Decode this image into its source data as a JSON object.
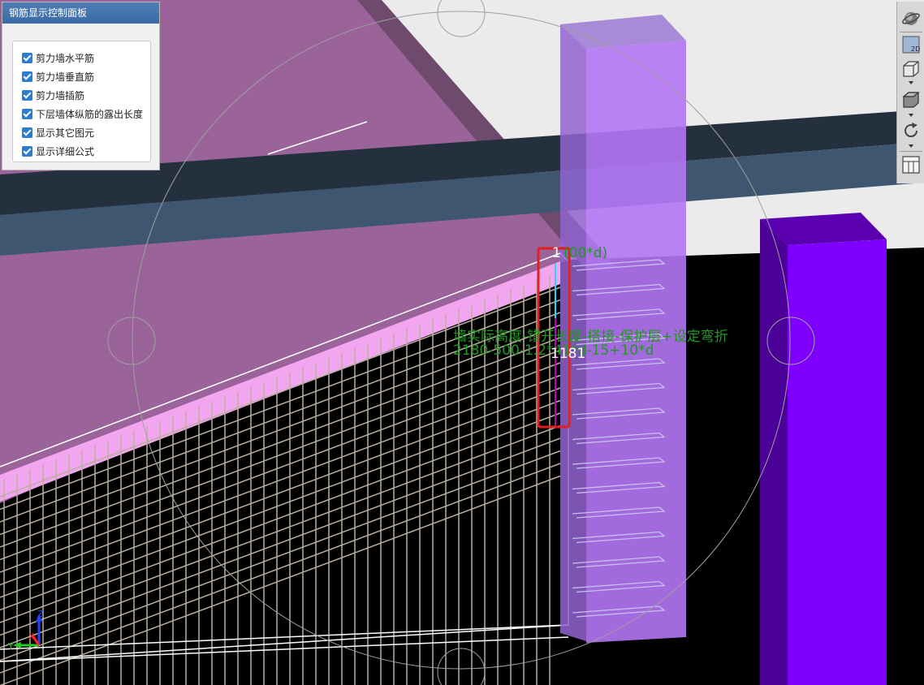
{
  "panel": {
    "title": "钢筋显示控制面板",
    "items": [
      {
        "label": "剪力墙水平筋",
        "checked": true
      },
      {
        "label": "剪力墙垂直筋",
        "checked": true
      },
      {
        "label": "剪力墙插筋",
        "checked": true
      },
      {
        "label": "下层墙体纵筋的露出长度",
        "checked": true
      },
      {
        "label": "显示其它图元",
        "checked": true
      },
      {
        "label": "显示详细公式",
        "checked": true
      }
    ],
    "accent_color": "#2b7cd3"
  },
  "viewport": {
    "formula_label": "墙实际高度-错开长度-搭接-保护层+设定弯折",
    "formula_expression": "2180-500-1.2*41*d-15+10*d",
    "top_label_number": "1",
    "top_label_expression": "(00*d)",
    "length_value": "1181",
    "axis_labels": {
      "x": "X",
      "y": "Y",
      "z": "Z"
    },
    "colors": {
      "slab": "#9a6399",
      "beam": "#3e5670",
      "column": "#8000ff",
      "rebar": "#b9b09f",
      "formula": "#1f9a1f",
      "highlight": "#e02020"
    }
  },
  "toolbar": {
    "buttons": [
      {
        "icon": "orbit-icon"
      },
      {
        "icon": "view-2d-icon",
        "label": "2D"
      },
      {
        "icon": "view-3d-box-icon"
      },
      {
        "icon": "solid-box-icon"
      },
      {
        "icon": "rotate-icon"
      },
      {
        "icon": "layout-grid-icon"
      }
    ]
  }
}
